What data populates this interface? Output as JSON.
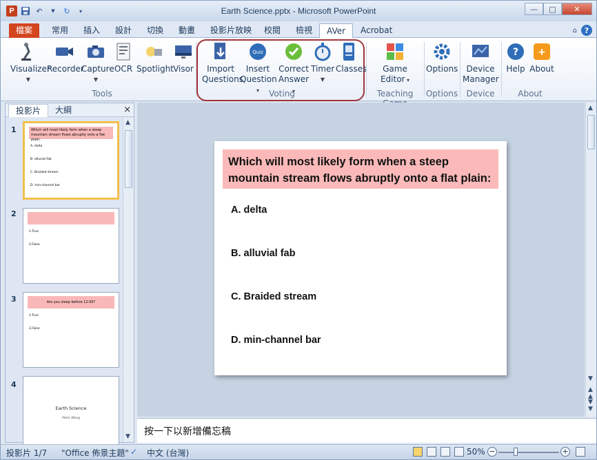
{
  "window": {
    "title": "Earth Science.pptx - Microsoft PowerPoint",
    "app_icon": "P",
    "controls": [
      "—",
      "□",
      "✕"
    ]
  },
  "tabs": [
    "檔案",
    "常用",
    "插入",
    "設計",
    "切換",
    "動畫",
    "投影片放映",
    "校閱",
    "檢視",
    "AVer",
    "Acrobat"
  ],
  "ribbon": {
    "groups": {
      "tools": "Tools",
      "voting": "Voting",
      "teaching_game": "Teaching Game",
      "options": "Options",
      "device": "Device",
      "about": "About"
    },
    "buttons": {
      "visualizer": "Visualizer",
      "recorder": "Recorder",
      "capture": "Capture",
      "ocr": "OCR",
      "spotlight": "Spotlight",
      "visor": "Visor",
      "import_questions_1": "Import",
      "import_questions_2": "Questions",
      "insert_question_1": "Insert",
      "insert_question_2": "Question",
      "correct_answer_1": "Correct",
      "correct_answer_2": "Answer",
      "timer": "Timer",
      "classes": "Classes",
      "game_editor_1": "Game",
      "game_editor_2": "Editor",
      "options": "Options",
      "device_manager_1": "Device",
      "device_manager_2": "Manager",
      "help": "Help",
      "about": "About"
    }
  },
  "slide_panel": {
    "tabs": [
      "投影片",
      "大綱"
    ],
    "close": "×",
    "thumbs": [
      {
        "num": "1",
        "band": "Which will most likely form when a steep mountain stream flows abruptly onto a flat plain:",
        "lines": [
          "A. delta",
          "B. alluvial fab",
          "C. Braided stream",
          "D. min-channel bar"
        ]
      },
      {
        "num": "2",
        "band": "",
        "lines": [
          "1.True",
          "2.False"
        ]
      },
      {
        "num": "3",
        "band": "Are you sleep before 12:00?",
        "lines": [
          "1.True",
          "2.False"
        ]
      },
      {
        "num": "4",
        "title": "Earth Science",
        "subtitle": "Peter Wang"
      }
    ]
  },
  "slide": {
    "question_line1": "Which will most likely form when a steep",
    "question_line2": "mountain stream flows abruptly onto a flat plain:",
    "options": [
      "A. delta",
      "B. alluvial fab",
      "C. Braided stream",
      "D. min-channel bar"
    ]
  },
  "notes_placeholder": "按一下以新增備忘稿",
  "status": {
    "slide_count": "投影片 1/7",
    "theme": "\"Office 佈景主題\"",
    "language": "中文 (台灣)",
    "zoom": "50%"
  },
  "colors": {
    "question_band": "#fbb9b9",
    "file_tab": "#d2451e",
    "highlight": "#a2353b",
    "selected_thumb": "#f2c04d"
  }
}
